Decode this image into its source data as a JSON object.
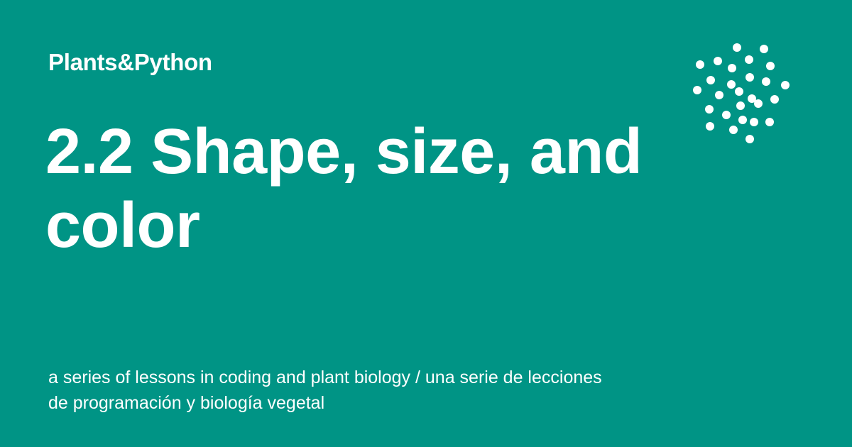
{
  "card": {
    "site_name": "Plants&Python",
    "title": "2.2 Shape, size, and color",
    "description": "a series of lessons in coding and plant biology / una serie de lecciones de programación y biología vegetal",
    "logo_icon": "dot-spiral-logo-icon"
  },
  "colors": {
    "background": "#009485",
    "foreground": "#ffffff"
  }
}
